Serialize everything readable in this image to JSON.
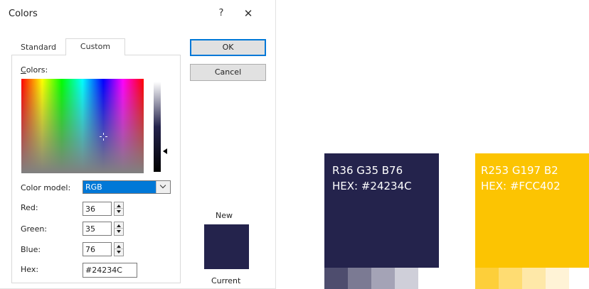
{
  "dialog": {
    "title": "Colors",
    "help_label": "?",
    "close_label": "✕",
    "tabs": [
      {
        "label": "Standard",
        "active": false
      },
      {
        "label": "Custom",
        "active": true
      }
    ],
    "colors_label": "Colors:",
    "color_model": {
      "label": "Color model:",
      "value": "RGB"
    },
    "red": {
      "label": "Red:",
      "value": "36"
    },
    "green": {
      "label": "Green:",
      "value": "35"
    },
    "blue": {
      "label": "Blue:",
      "value": "76"
    },
    "hex": {
      "label": "Hex:",
      "value": "#24234C"
    },
    "ok_label": "OK",
    "cancel_label": "Cancel",
    "new_label": "New",
    "current_label": "Current",
    "selected_color": "#24234C"
  },
  "swatches": [
    {
      "rgb_text": "R36 G35 B76",
      "hex_text": "HEX: #24234C",
      "color": "#24234C",
      "tints": [
        "#4e4d6e",
        "#7b7a93",
        "#a4a3b6",
        "#cfcfd9"
      ]
    },
    {
      "rgb_text": "R253 G197 B2",
      "hex_text": "HEX: #FCC402",
      "color": "#FCC402",
      "tints": [
        "#fdcf3a",
        "#fedc72",
        "#fee8a8",
        "#fff3d6"
      ]
    }
  ],
  "icons": {
    "help": "question-icon",
    "close": "close-icon",
    "dropdown": "chevron-down-icon",
    "spin_up": "arrow-up-icon",
    "spin_down": "arrow-down-icon",
    "luminance": "triangle-pointer-icon",
    "crosshair": "crosshair-icon"
  }
}
